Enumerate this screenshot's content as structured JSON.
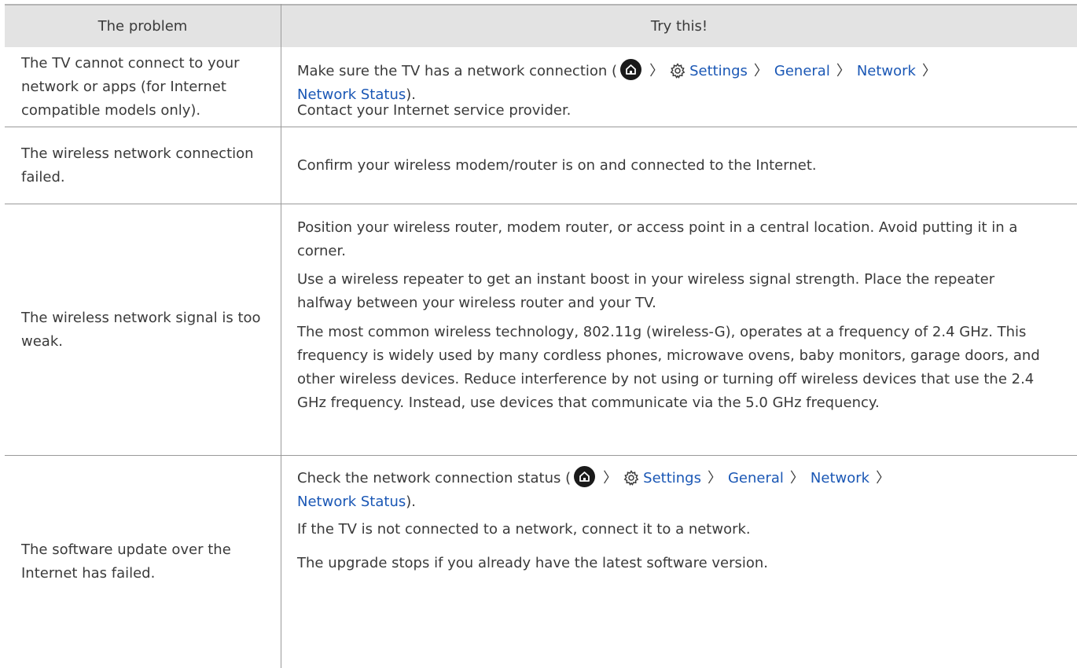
{
  "header": {
    "problem_col": "The problem",
    "solution_col": "Try this!"
  },
  "rows": [
    {
      "problem": "The TV cannot connect to your network or apps (for Internet compatible models only).",
      "path_intro": "Make sure the TV has a network connection (",
      "path": [
        "Settings",
        "General",
        "Network",
        "Network Status"
      ],
      "path_close": ").",
      "note": "Contact your Internet service provider."
    },
    {
      "problem": "The wireless network connection failed.",
      "solution": "Confirm your wireless modem/router is on and connected to the Internet."
    },
    {
      "problem": "The wireless network signal is too weak.",
      "solutions": [
        "Position your wireless router, modem router, or access point in a central location. Avoid putting it in a corner.",
        "Use a wireless repeater to get an instant boost in your wireless signal strength. Place the repeater halfway between your wireless router and your TV.",
        "The most common wireless technology, 802.11g (wireless-G), operates at a frequency of 2.4 GHz. This frequency is widely used by many cordless phones, microwave ovens, baby monitors, garage doors, and other wireless devices. Reduce interference by not using or turning off wireless devices that use the 2.4 GHz frequency. Instead, use devices that communicate via the 5.0 GHz frequency."
      ]
    },
    {
      "problem": "The software update over the Internet has failed.",
      "path_intro": "Check the network connection status (",
      "path": [
        "Settings",
        "General",
        "Network",
        "Network Status"
      ],
      "path_close": ").",
      "notes": [
        "If the TV is not connected to a network, connect it to a network.",
        "The upgrade stops if you already have the latest software version."
      ]
    }
  ],
  "icons": {
    "home": "home-icon",
    "settings": "gear-icon",
    "separator": "chevron-right-icon"
  },
  "colors": {
    "link": "#1a57b5",
    "header_bg": "#e3e3e3",
    "rule": "#9a9a9a"
  }
}
